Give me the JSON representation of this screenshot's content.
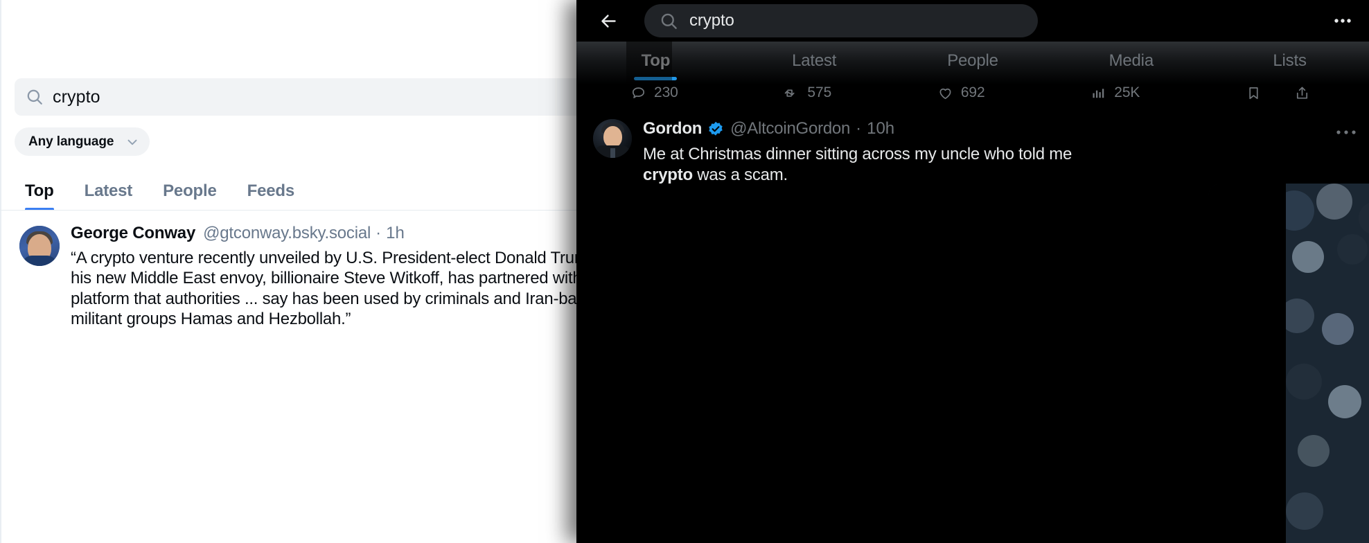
{
  "left_app": {
    "name": "Bluesky Search",
    "search": {
      "value": "crypto",
      "placeholder": "Search",
      "icon": "search-icon",
      "clear_icon": "close-icon"
    },
    "language_filter": {
      "label": "Any language",
      "chevron_icon": "chevron-down-icon"
    },
    "tabs": [
      {
        "label": "Top",
        "active": true
      },
      {
        "label": "Latest",
        "active": false
      },
      {
        "label": "People",
        "active": false
      },
      {
        "label": "Feeds",
        "active": false
      }
    ],
    "accent_color": "#3b7ff2",
    "post": {
      "display_name": "George Conway",
      "handle": "@gtconway.bsky.social",
      "separator": "·",
      "timestamp": "1h",
      "text": "“A crypto venture recently unveiled by U.S. President-elect Donald Trump and his new Middle East envoy, billionaire Steve Witkoff, has partnered with a crypto platform that authorities ... say has been used by criminals and Iran-backed militant groups Hamas and Hezbollah.”",
      "avatar": "avatar-george-conway"
    }
  },
  "right_app": {
    "name": "X Search",
    "theme": "dark",
    "topbar": {
      "back_icon": "arrow-left-icon",
      "search": {
        "value": "crypto",
        "placeholder": "Search",
        "icon": "search-icon"
      },
      "more_icon": "ellipsis-horizontal-icon"
    },
    "tabs": [
      {
        "label": "Top",
        "active": true
      },
      {
        "label": "Latest",
        "active": false
      },
      {
        "label": "People",
        "active": false
      },
      {
        "label": "Media",
        "active": false
      },
      {
        "label": "Lists",
        "active": false
      }
    ],
    "accent_color": "#1d9bf0",
    "metrics": [
      {
        "icon": "reply-icon",
        "value": "230"
      },
      {
        "icon": "repost-icon",
        "value": "575"
      },
      {
        "icon": "like-icon",
        "value": "692"
      },
      {
        "icon": "views-icon",
        "value": "25K"
      },
      {
        "icon": "bookmark-icon",
        "value": ""
      },
      {
        "icon": "share-icon",
        "value": ""
      }
    ],
    "post": {
      "display_name": "Gordon",
      "verified": true,
      "verified_icon": "verified-badge-icon",
      "handle": "@AltcoinGordon",
      "separator": "·",
      "timestamp": "10h",
      "text_before": "Me at Christmas dinner sitting across my uncle who told me ",
      "text_highlight": "crypto",
      "text_after": " was a scam.",
      "more_icon": "ellipsis-horizontal-icon",
      "avatar": "avatar-altcoin-gordon",
      "media": "crowd-video-thumbnail"
    }
  }
}
